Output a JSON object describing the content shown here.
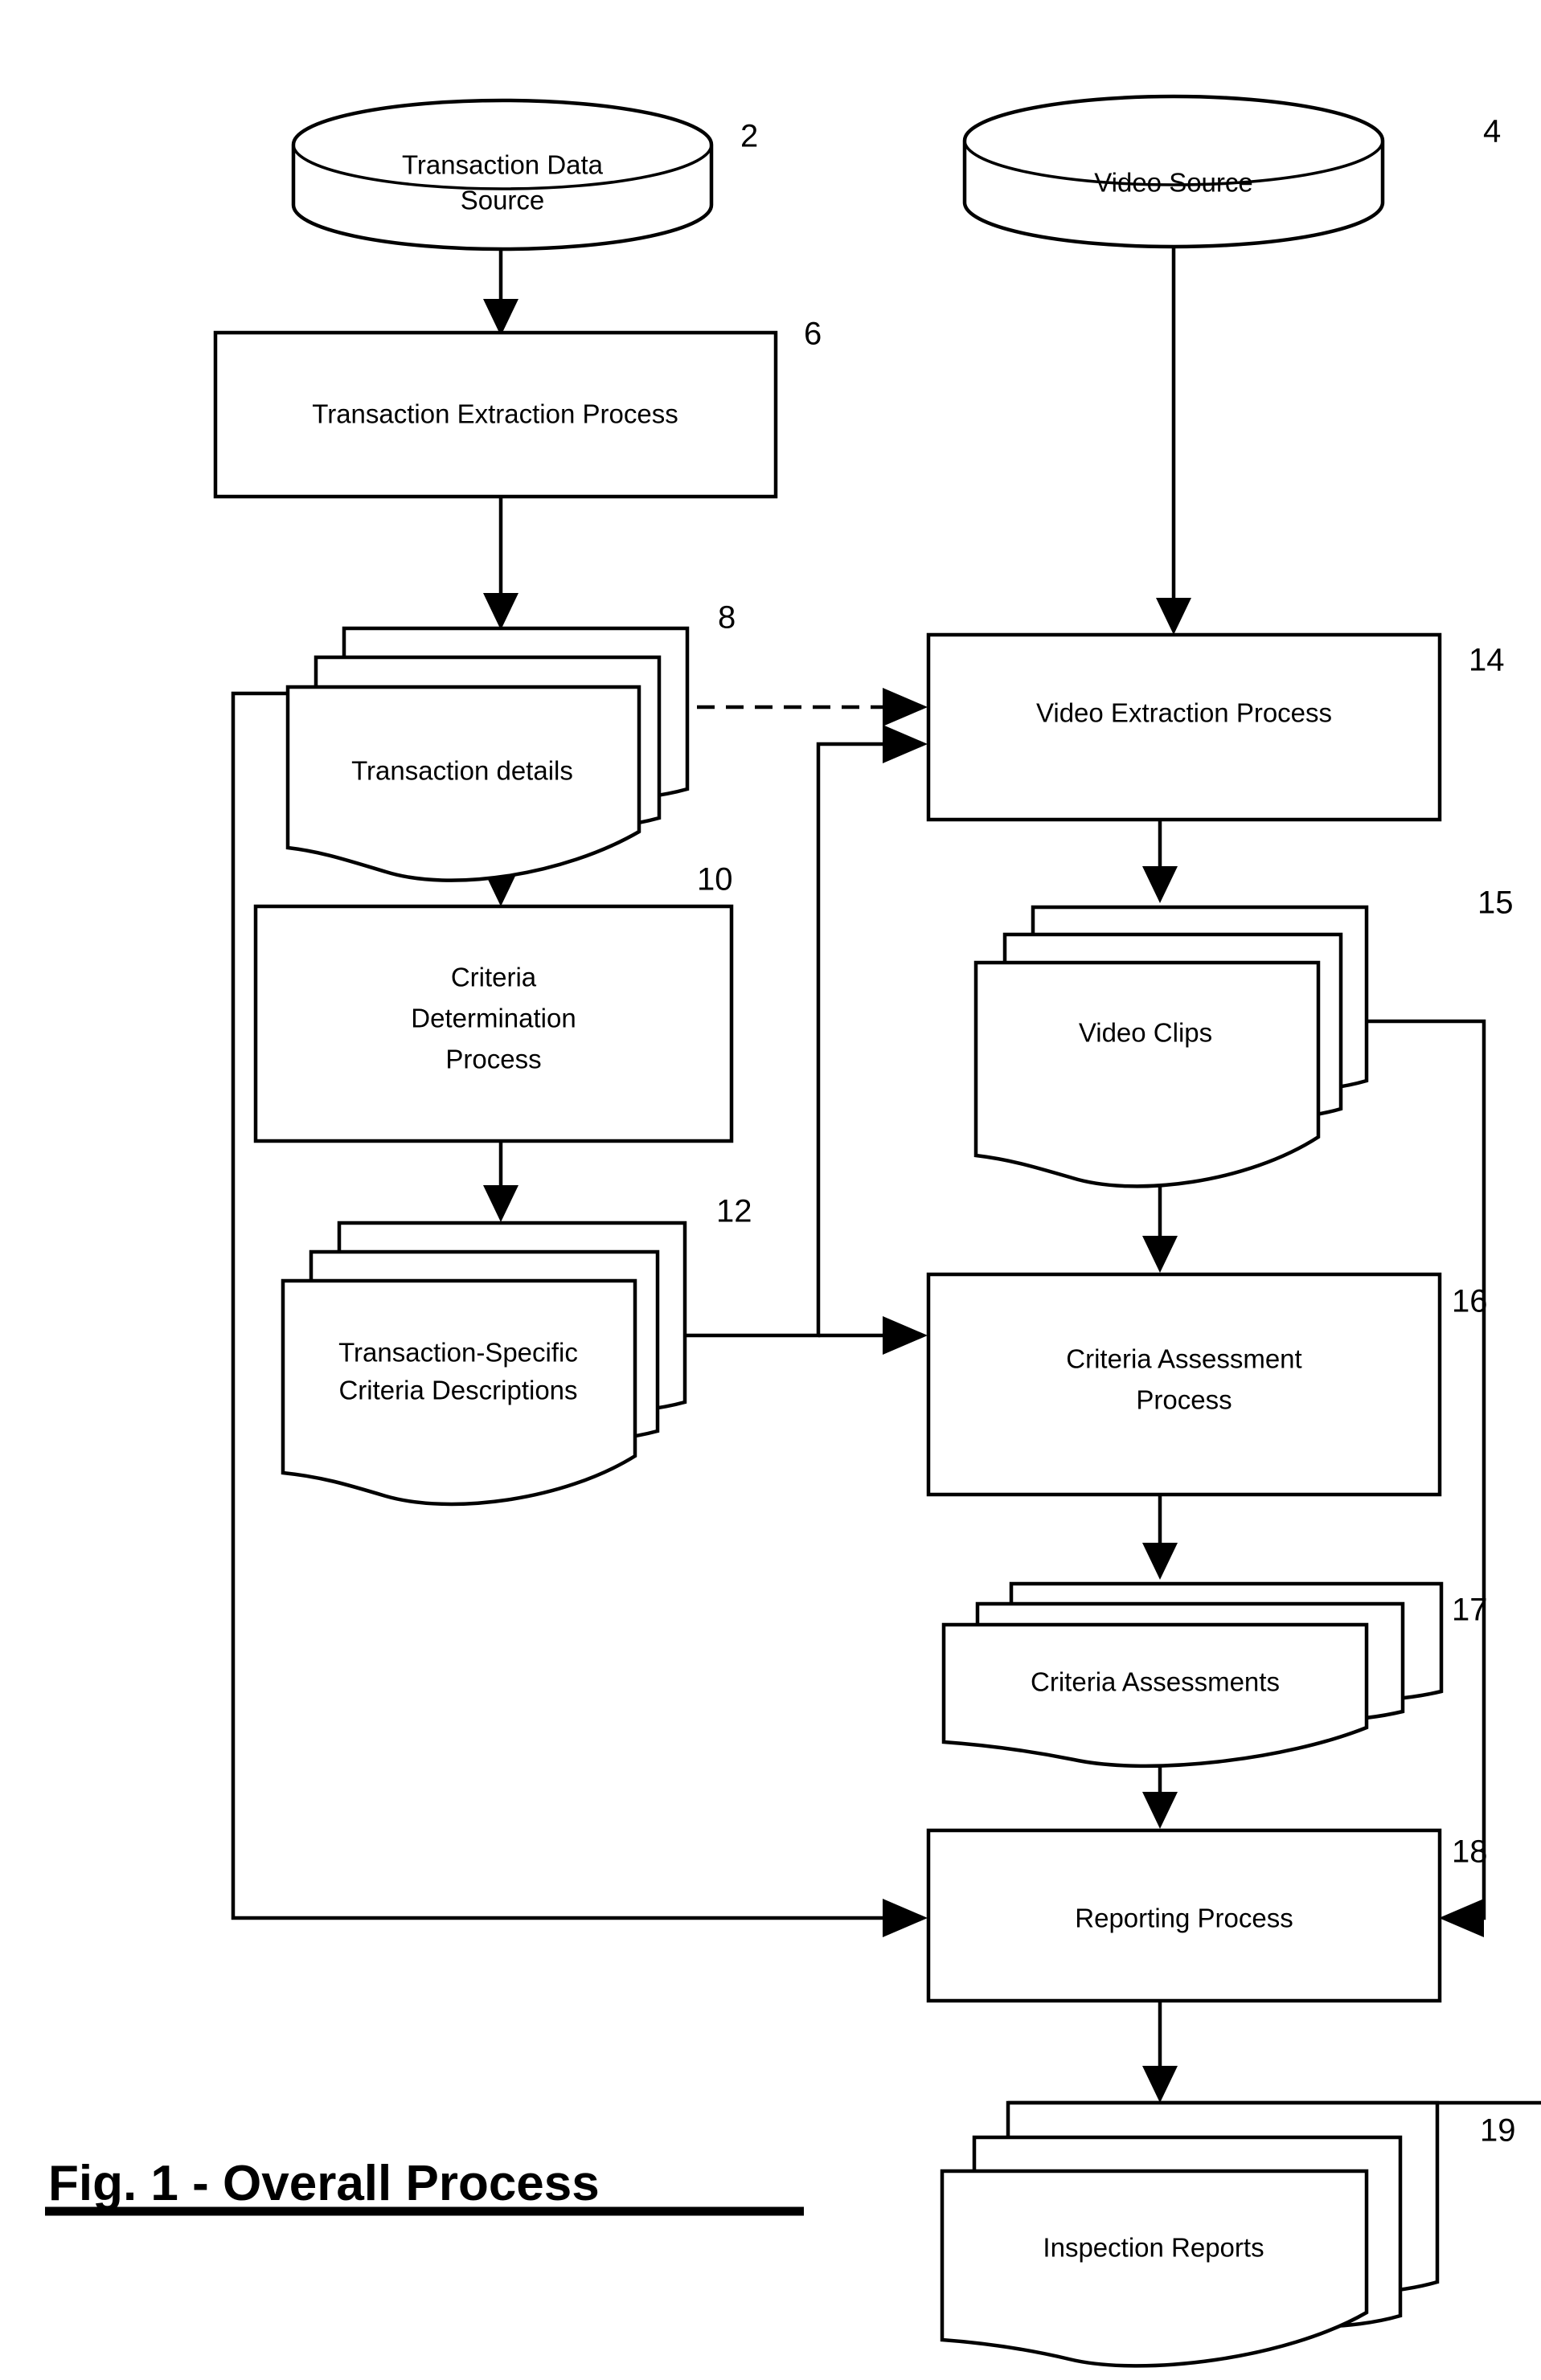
{
  "figure": {
    "caption": "Fig. 1 - Overall Process",
    "caption_underlined": true,
    "line_color": "#000000",
    "background": "#ffffff"
  },
  "nodes": {
    "transaction_data_source": {
      "label_line1": "Transaction Data",
      "label_line2": "Source",
      "ref": "2",
      "shape": "cylinder"
    },
    "video_source": {
      "label_line1": "Video Source",
      "label_line2": "",
      "ref": "4",
      "shape": "cylinder"
    },
    "transaction_extraction_process": {
      "label_line1": "Transaction Extraction Process",
      "label_line2": "",
      "ref": "6",
      "shape": "process-box"
    },
    "transaction_details": {
      "label_line1": "Transaction details",
      "label_line2": "",
      "ref": "8",
      "shape": "document-stack"
    },
    "criteria_determination_process": {
      "label_line1": "Criteria",
      "label_line2": "Determination",
      "label_line3": "Process",
      "ref": "10",
      "shape": "process-box"
    },
    "transaction_specific_criteria_descriptions": {
      "label_line1": "Transaction-Specific",
      "label_line2": "Criteria Descriptions",
      "ref": "12",
      "shape": "document-stack"
    },
    "video_extraction_process": {
      "label_line1": "Video Extraction Process",
      "label_line2": "",
      "ref": "14",
      "shape": "process-box"
    },
    "video_clips": {
      "label_line1": "Video Clips",
      "label_line2": "",
      "ref": "15",
      "shape": "document-stack"
    },
    "criteria_assessment_process": {
      "label_line1": "Criteria Assessment",
      "label_line2": "Process",
      "ref": "16",
      "shape": "process-box"
    },
    "criteria_assessments": {
      "label_line1": "Criteria Assessments",
      "label_line2": "",
      "ref": "17",
      "shape": "document-stack"
    },
    "reporting_process": {
      "label_line1": "Reporting Process",
      "label_line2": "",
      "ref": "18",
      "shape": "process-box"
    },
    "inspection_reports": {
      "label_line1": "Inspection Reports",
      "label_line2": "",
      "ref": "19",
      "shape": "document-stack"
    }
  },
  "connections": [
    {
      "from": "transaction_data_source",
      "to": "transaction_extraction_process",
      "style": "solid"
    },
    {
      "from": "transaction_extraction_process",
      "to": "transaction_details",
      "style": "solid"
    },
    {
      "from": "transaction_details",
      "to": "criteria_determination_process",
      "style": "solid"
    },
    {
      "from": "transaction_details",
      "to": "video_extraction_process",
      "style": "dashed"
    },
    {
      "from": "transaction_details",
      "to": "reporting_process",
      "style": "solid"
    },
    {
      "from": "criteria_determination_process",
      "to": "transaction_specific_criteria_descriptions",
      "style": "solid"
    },
    {
      "from": "transaction_specific_criteria_descriptions",
      "to": "video_extraction_process",
      "style": "solid"
    },
    {
      "from": "transaction_specific_criteria_descriptions",
      "to": "criteria_assessment_process",
      "style": "solid"
    },
    {
      "from": "video_source",
      "to": "video_extraction_process",
      "style": "solid"
    },
    {
      "from": "video_extraction_process",
      "to": "video_clips",
      "style": "solid"
    },
    {
      "from": "video_clips",
      "to": "criteria_assessment_process",
      "style": "solid"
    },
    {
      "from": "video_clips",
      "to": "reporting_process",
      "style": "solid"
    },
    {
      "from": "criteria_assessment_process",
      "to": "criteria_assessments",
      "style": "solid"
    },
    {
      "from": "criteria_assessments",
      "to": "reporting_process",
      "style": "solid"
    },
    {
      "from": "reporting_process",
      "to": "inspection_reports",
      "style": "solid"
    }
  ]
}
